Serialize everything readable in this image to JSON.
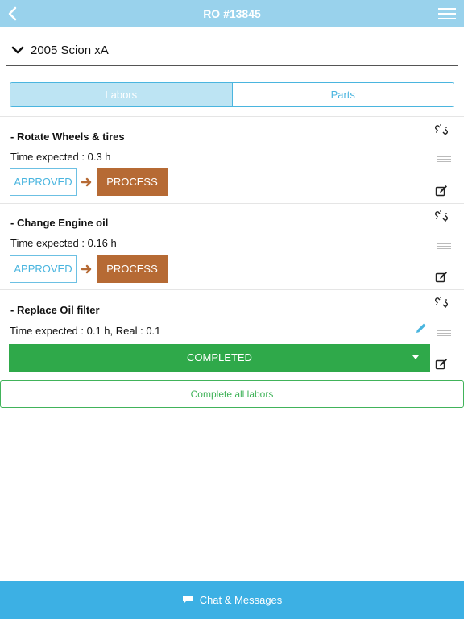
{
  "header": {
    "title": "RO #13845"
  },
  "vehicle": {
    "name": "2005 Scion xA"
  },
  "tabs": [
    {
      "label": "Labors"
    },
    {
      "label": "Parts"
    }
  ],
  "labors": [
    {
      "name": "- Rotate Wheels & tires",
      "time": "Time expected : 0.3 h",
      "approved_label": "APPROVED",
      "process_label": "PROCESS"
    },
    {
      "name": "- Change Engine oil",
      "time": "Time expected : 0.16 h",
      "approved_label": "APPROVED",
      "process_label": "PROCESS"
    },
    {
      "name": "- Replace Oil filter",
      "time": "Time expected : 0.1 h,  Real : 0.1",
      "status": "COMPLETED"
    }
  ],
  "actions": {
    "complete_all_label": "Complete all labors"
  },
  "footer": {
    "chat_label": "Chat & Messages"
  },
  "colors": {
    "header_bg": "#99d2ec",
    "accent_blue": "#4ab5df",
    "process_brown": "#b66a34",
    "completed_green": "#2fa94a",
    "footer_bg": "#3cb0e4"
  },
  "icons": [
    "back-arrow-icon",
    "hamburger-menu-icon",
    "chevron-down-icon",
    "unlink-icon",
    "drag-handle-icon",
    "edit-icon",
    "pencil-icon",
    "arrow-right-icon",
    "chat-bubble-icon"
  ]
}
